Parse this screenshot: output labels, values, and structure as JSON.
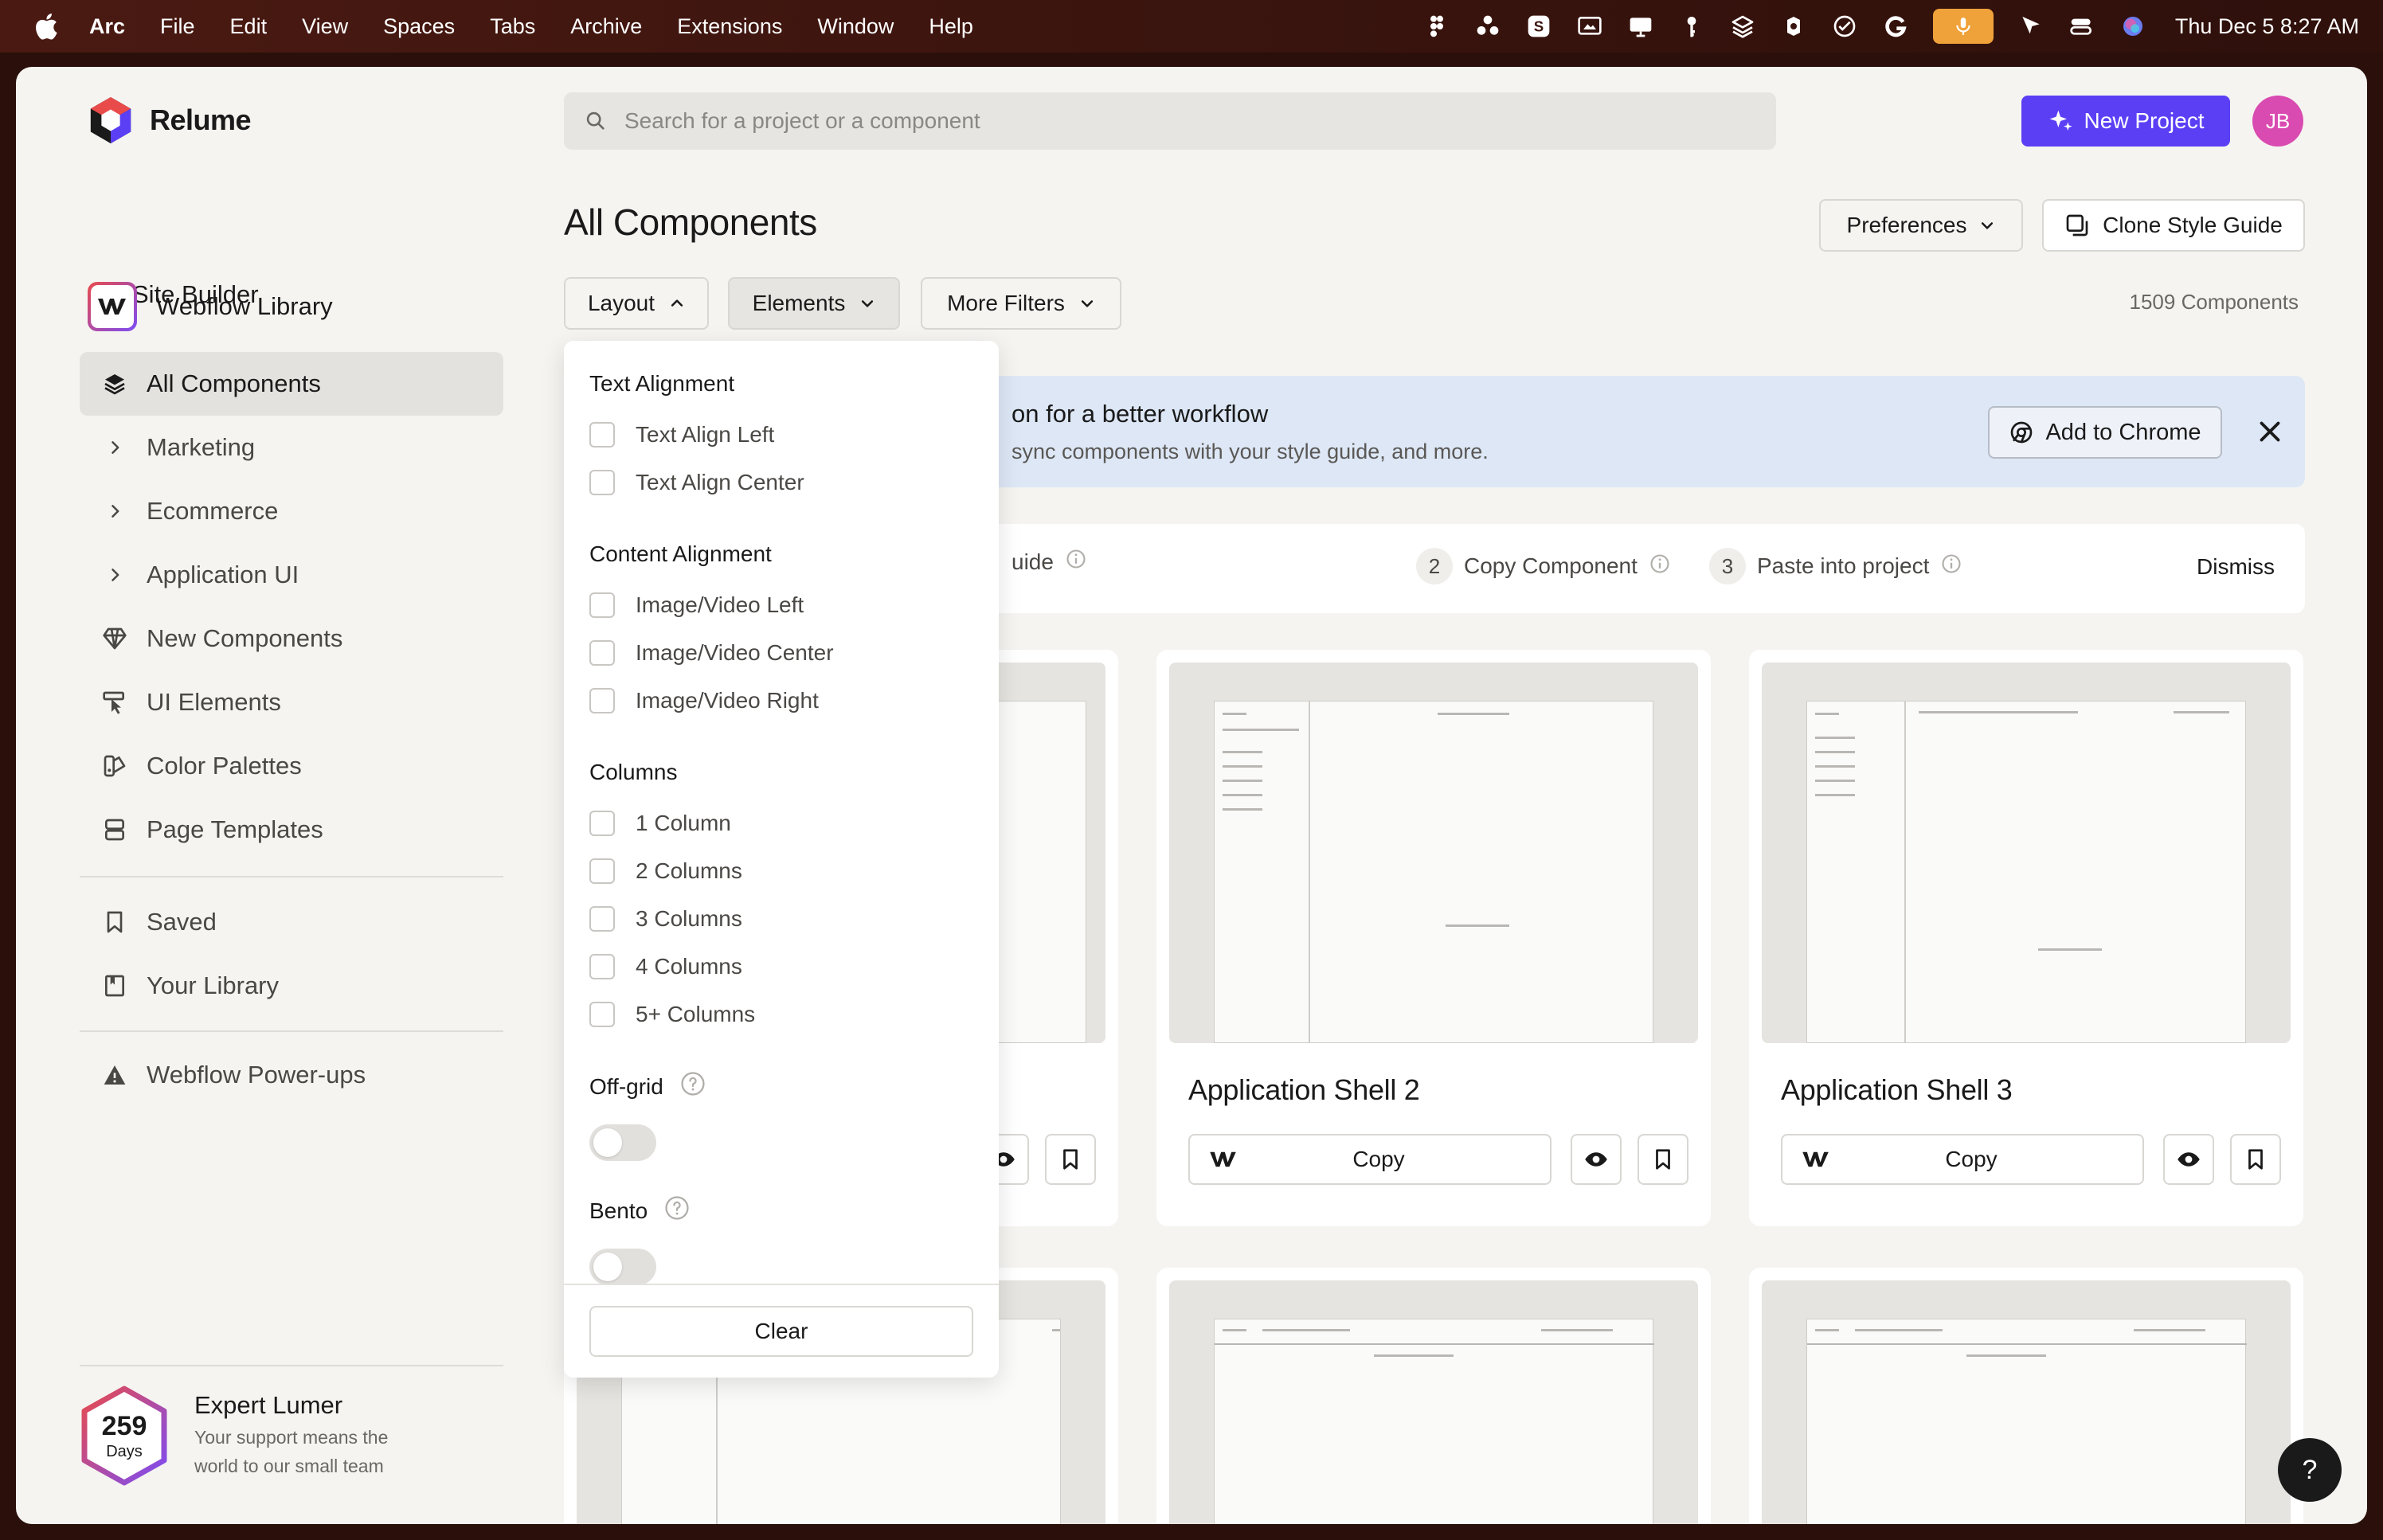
{
  "menubar": {
    "app": "Arc",
    "items": [
      "File",
      "Edit",
      "View",
      "Spaces",
      "Tabs",
      "Archive",
      "Extensions",
      "Window",
      "Help"
    ],
    "clock": "Thu Dec 5  8:27 AM"
  },
  "header": {
    "brand": "Relume",
    "search_placeholder": "Search for a project or a component",
    "new_project": "New Project",
    "avatar_initials": "JB"
  },
  "sidebar": {
    "back_label": "Site Builder",
    "library": "Webflow Library",
    "items": [
      {
        "label": "All Components",
        "icon": "layers-icon",
        "active": true
      },
      {
        "label": "Marketing",
        "icon": "chevron-right-icon"
      },
      {
        "label": "Ecommerce",
        "icon": "chevron-right-icon"
      },
      {
        "label": "Application UI",
        "icon": "chevron-right-icon"
      },
      {
        "label": "New Components",
        "icon": "gem-icon"
      },
      {
        "label": "UI Elements",
        "icon": "ui-elements-icon"
      },
      {
        "label": "Color Palettes",
        "icon": "color-palette-icon"
      },
      {
        "label": "Page Templates",
        "icon": "page-templates-icon"
      }
    ],
    "secondary": [
      {
        "label": "Saved",
        "icon": "bookmark-icon"
      },
      {
        "label": "Your Library",
        "icon": "library-icon"
      }
    ],
    "powerups": "Webflow Power-ups",
    "expert": {
      "days": "259",
      "days_label": "Days",
      "title": "Expert Lumer",
      "subtitle": "Your support means the world to our small team"
    }
  },
  "main": {
    "title": "All Components",
    "preferences": "Preferences",
    "clone_style_guide": "Clone Style Guide",
    "filters": [
      "Layout",
      "Elements",
      "More Filters"
    ],
    "count": "1509 Components",
    "banner": {
      "title": "on for a better workflow",
      "subtitle": "sync components with your style guide, and more.",
      "add_to_chrome": "Add to Chrome"
    },
    "steps": {
      "step1_partial": "uide",
      "step2_num": "2",
      "step2": "Copy Component",
      "step3_num": "3",
      "step3": "Paste into project",
      "dismiss": "Dismiss"
    },
    "cards": [
      {
        "title": "Application Shell 2",
        "copy": "Copy"
      },
      {
        "title": "Application Shell 3",
        "copy": "Copy"
      }
    ]
  },
  "dropdown": {
    "text_alignment": "Text Alignment",
    "text_options": [
      "Text Align Left",
      "Text Align Center"
    ],
    "content_alignment": "Content Alignment",
    "content_options": [
      "Image/Video Left",
      "Image/Video Center",
      "Image/Video Right"
    ],
    "columns": "Columns",
    "column_options": [
      "1 Column",
      "2 Columns",
      "3 Columns",
      "4 Columns",
      "5+ Columns"
    ],
    "off_grid": "Off-grid",
    "bento": "Bento",
    "clear": "Clear"
  },
  "help_fab": "?"
}
